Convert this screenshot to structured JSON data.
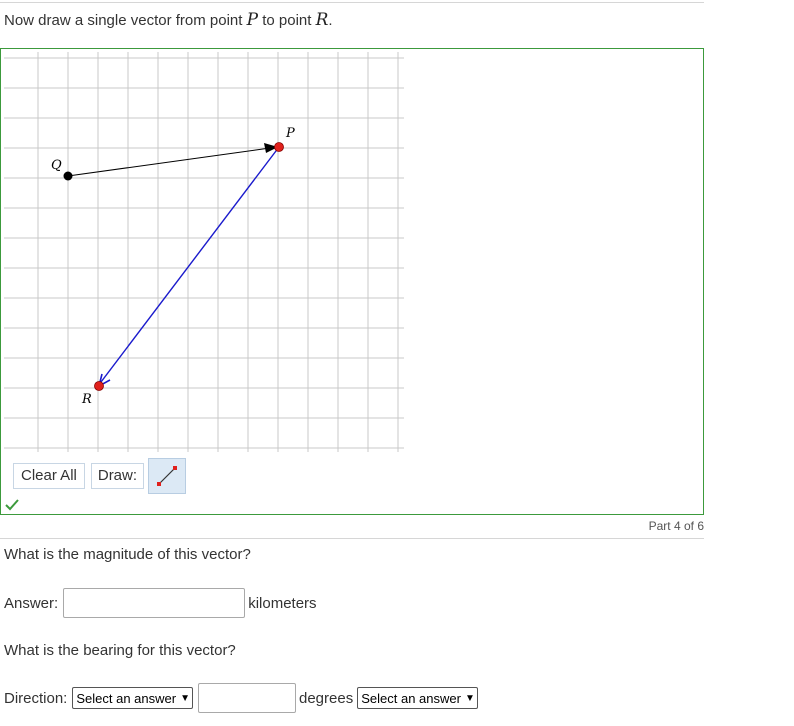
{
  "instruction": {
    "prefix": "Now draw a single vector from point ",
    "from_var": "P",
    "middle": " to point ",
    "to_var": "R",
    "suffix": "."
  },
  "graph": {
    "points": {
      "Q": {
        "label": "Q",
        "color": "#000000"
      },
      "P": {
        "label": "P",
        "color": "#e0201c"
      },
      "R": {
        "label": "R",
        "color": "#e0201c"
      }
    },
    "vector_QP_color": "#000000",
    "vector_PR_color": "#1a1acc",
    "grid_color": "#c8c8c8"
  },
  "tools": {
    "clear_all": "Clear All",
    "draw_label": "Draw:"
  },
  "status": {
    "part": "Part 4 of 6",
    "correct_color": "#3c9a3c"
  },
  "question1": {
    "text": "What is the magnitude of this vector?",
    "answer_label": "Answer:",
    "answer_value": "",
    "units": "kilometers"
  },
  "question2": {
    "text": "What is the bearing for this vector?",
    "direction_label": "Direction:",
    "direction_select": "Select an answer",
    "degrees_value": "",
    "degrees_label": "degrees",
    "second_select": "Select an answer"
  }
}
